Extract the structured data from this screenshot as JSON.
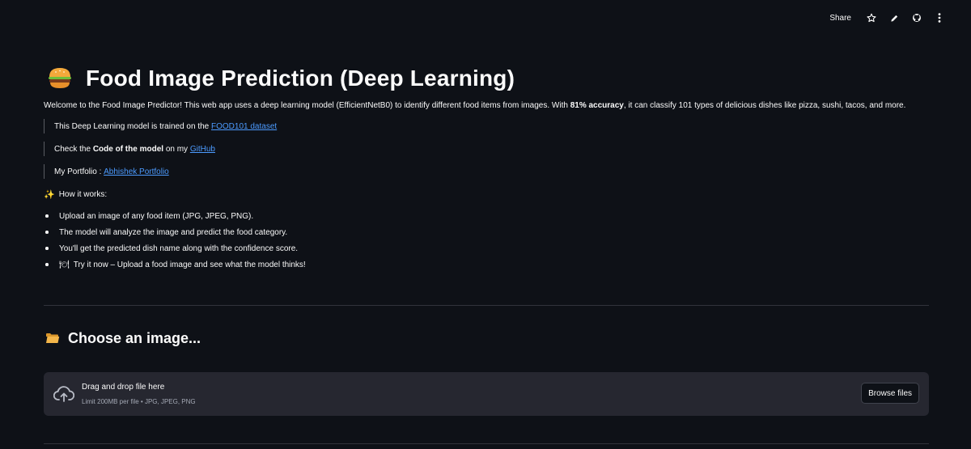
{
  "toolbar": {
    "share_label": "Share",
    "icons": [
      "star-icon",
      "pencil-icon",
      "github-icon",
      "more-vertical-icon"
    ]
  },
  "header": {
    "emoji_icon": "burger-icon",
    "title": "Food Image Prediction (Deep Learning)"
  },
  "intro": {
    "before_bold": "Welcome to the Food Image Predictor! This web app uses a deep learning model (EfficientNetB0) to identify different food items from images. With ",
    "bold": "81% accuracy",
    "after_bold": ", it can classify 101 types of delicious dishes like pizza, sushi, tacos, and more."
  },
  "quotes": {
    "dataset_prefix": "This Deep Learning model is trained on the ",
    "dataset_link": "FOOD101 dataset",
    "code_prefix": "Check the ",
    "code_bold": "Code of the model",
    "code_middle": " on my ",
    "code_link": "GitHub",
    "portfolio_prefix": "My Portfolio : ",
    "portfolio_link": "Abhishek Portfolio"
  },
  "how_it_works": {
    "icon": "sparkles-icon",
    "heading": "How it works:",
    "items": [
      "Upload an image of any food item (JPG, JPEG, PNG).",
      "The model will analyze the image and predict the food category.",
      "You'll get the predicted dish name along with the confidence score.",
      "Try it now – Upload a food image and see what the model thinks!"
    ],
    "last_item_icon": "plate-cutlery-icon"
  },
  "uploader": {
    "section_icon": "folder-icon",
    "section_title": "Choose an image...",
    "drag_text": "Drag and drop file here",
    "limit_text": "Limit 200MB per file • JPG, JPEG, PNG",
    "browse_label": "Browse files",
    "cloud_icon": "cloud-upload-icon"
  }
}
